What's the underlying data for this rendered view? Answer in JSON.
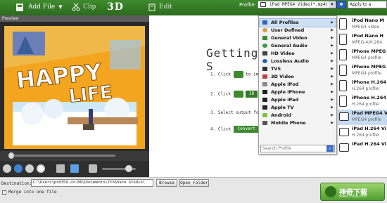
{
  "toolbar": {
    "add_file": "Add File",
    "clip": "Clip",
    "three_d": "3D",
    "edit": "Edit",
    "profile_label": "Profile",
    "profile_value": "iPad MPEG4 Video(*.mp4)",
    "apply_to": "Apply to a"
  },
  "preview": {
    "header": "Preview",
    "image_title_1": "HAPPY",
    "image_title_2": "LIFE"
  },
  "getting_started": {
    "title": "Getting S",
    "step1": "1. Click",
    "step1_tail": "to impo",
    "step2": "2. Click",
    "step2_tail": "3D",
    "step3": "3. Select output fo",
    "step4": "4. Click",
    "convert": "Convert"
  },
  "profile_menu": {
    "items": [
      {
        "label": "All Profiles",
        "icon": "profiles-icon"
      },
      {
        "label": "User Defined",
        "icon": "user-icon"
      },
      {
        "label": "General Video",
        "icon": "video-icon"
      },
      {
        "label": "General Audio",
        "icon": "audio-icon"
      },
      {
        "label": "HD Video",
        "icon": "hd-icon"
      },
      {
        "label": "Lossless Audio",
        "icon": "lossless-icon"
      },
      {
        "label": "TVS",
        "icon": "tv-icon"
      },
      {
        "label": "3D Video",
        "icon": "3d-icon"
      },
      {
        "label": "Apple iPod",
        "icon": "ipod-icon"
      },
      {
        "label": "Apple iPhone",
        "icon": "iphone-icon"
      },
      {
        "label": "Apple iPad",
        "icon": "ipad-icon"
      },
      {
        "label": "Apple TV",
        "icon": "appletv-icon"
      },
      {
        "label": "Android",
        "icon": "android-icon"
      },
      {
        "label": "Mobile Phone",
        "icon": "phone-icon"
      }
    ],
    "search_placeholder": "Search Profile"
  },
  "profile_list": [
    {
      "name": "iPod Nano M",
      "desc": "MPEG4 video"
    },
    {
      "name": "iPod Nano H",
      "desc": "MPEG-4/H.264"
    },
    {
      "name": "iPhone MPEG",
      "desc": "MPEG4 profile"
    },
    {
      "name": "iPhone MPEG",
      "desc": "MPEG4 profile"
    },
    {
      "name": "iPhone H.264",
      "desc": "H.264 profile"
    },
    {
      "name": "iPhone H.264",
      "desc": "H.264 profile"
    },
    {
      "name": "iPad MPEG4 V",
      "desc": "MPEG4 profile"
    },
    {
      "name": "iPad H.264 Vi",
      "desc": "H.264 profile"
    },
    {
      "name": "iPad H.264 Vi",
      "desc": "H.264 profile"
    }
  ],
  "bottom": {
    "destination_label": "Destination:",
    "destination_value": "C:\\Users\\pc0359.cn-06\\Documents\\TthShare Studio\\",
    "browse": "Browse",
    "open_folder": "Open Folder",
    "merge": "Merge into one file",
    "brand_name": "神奇下载",
    "brand_url": "www.cnhdj.com"
  },
  "colors": {
    "toolbar_green": "#2f7a24",
    "accent_blue": "#3a6fc8",
    "highlight": "#cfe0f6"
  }
}
